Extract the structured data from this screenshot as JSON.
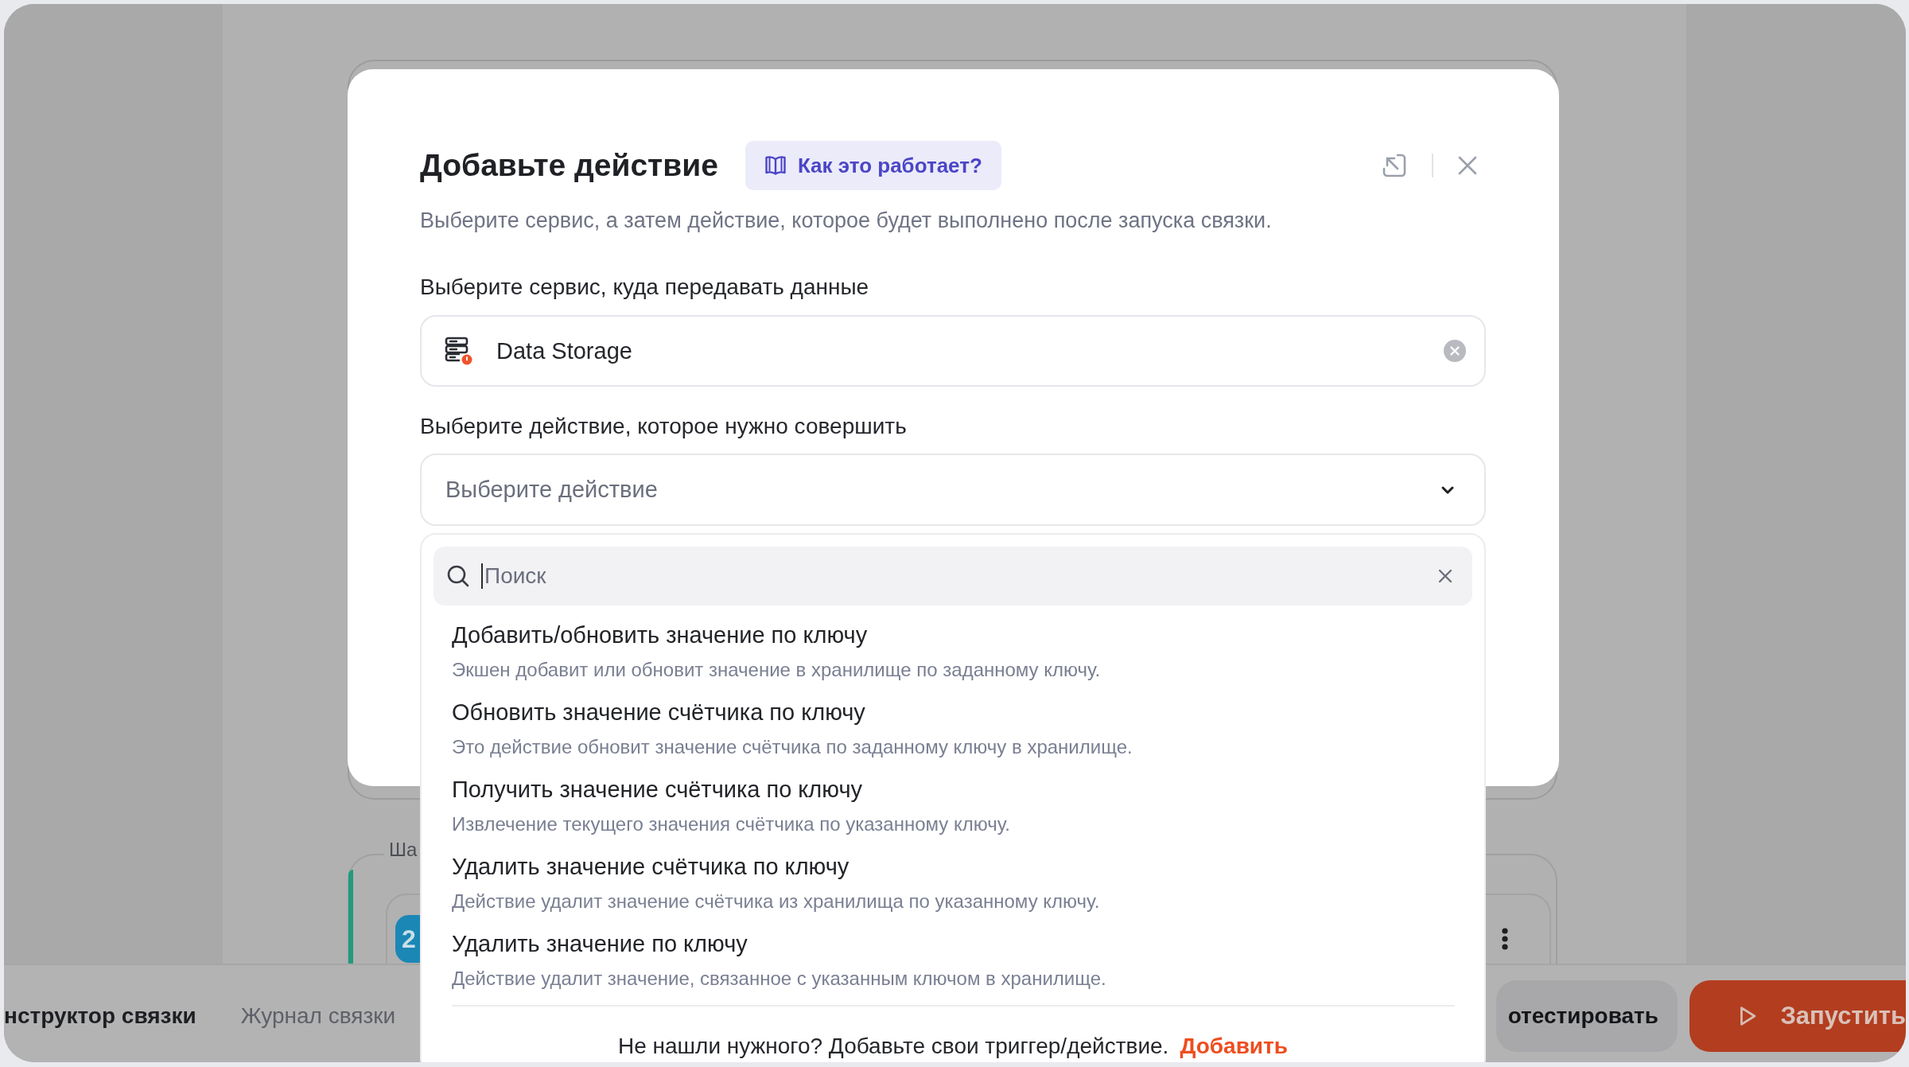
{
  "bottom_bar": {
    "tabs": [
      {
        "label": "нструктор связки",
        "selected": true
      },
      {
        "label": "Журнал связки",
        "selected": false
      }
    ],
    "test_button": "отестировать",
    "run_button": "Запустить"
  },
  "step_card": {
    "label": "Ша",
    "badge": "2"
  },
  "modal": {
    "title": "Добавьте действие",
    "help_button": "Как это работает?",
    "subtitle": "Выберите сервис, а затем действие, которое будет выполнено после запуска связки.",
    "service_label": "Выберите сервис, куда передавать данные",
    "service_field": {
      "value": "Data Storage"
    },
    "action_label": "Выберите действие, которое нужно совершить",
    "action_select": {
      "placeholder": "Выберите действие",
      "expanded": true
    },
    "dropdown": {
      "search": {
        "placeholder": "Поиск"
      },
      "actions": [
        {
          "title": "Добавить/обновить значение по ключу",
          "description": "Экшен добавит или обновит значение в хранилище по заданному ключу."
        },
        {
          "title": "Обновить значение счётчика по ключу",
          "description": "Это действие обновит значение счётчика по заданному ключу в хранилище."
        },
        {
          "title": "Получить значение счётчика по ключу",
          "description": "Извлечение текущего значения счётчика по указанному ключу."
        },
        {
          "title": "Удалить значение счётчика по ключу",
          "description": "Действие удалит значение счётчика из хранилища по указанному ключу."
        },
        {
          "title": "Удалить значение по ключу",
          "description": "Действие удалит значение, связанное с указанным ключом в хранилище."
        }
      ],
      "footer_text": "Не нашли нужного? Добавьте свои триггер/действие.",
      "footer_link": "Добавить"
    }
  }
}
